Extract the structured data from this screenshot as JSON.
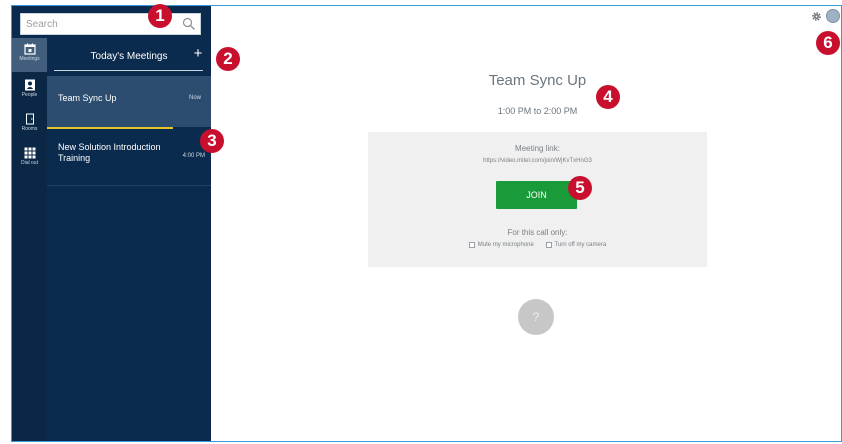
{
  "search": {
    "placeholder": "Search"
  },
  "rail": {
    "items": [
      {
        "label": "Meetings",
        "icon": "calendar-icon",
        "active": true
      },
      {
        "label": "People",
        "icon": "contact-card-icon",
        "active": false
      },
      {
        "label": "Rooms",
        "icon": "door-icon",
        "active": false
      },
      {
        "label": "Dial out",
        "icon": "dialpad-icon",
        "active": false
      }
    ]
  },
  "list": {
    "title": "Today's Meetings",
    "add_label": "+",
    "meetings": [
      {
        "name": "Team Sync Up",
        "time": "Now",
        "progress": 0.77
      },
      {
        "name": "New Solution Introduction Training",
        "time": "4:00 PM"
      }
    ]
  },
  "detail": {
    "title": "Team Sync Up",
    "time_range": "1:00 PM to 2:00 PM",
    "link_label": "Meeting link:",
    "link_url": "https://video.mitel.com/join/WjKvTxHnG3",
    "join_label": "JOIN",
    "call_only_label": "For this call only:",
    "mute_label": "Mute my microphone",
    "camera_label": "Turn off my camera",
    "help_label": "?"
  },
  "badges": [
    "1",
    "2",
    "3",
    "4",
    "5",
    "6"
  ],
  "colors": {
    "navy": "#0b2b4e",
    "selected": "#2c4d70",
    "progress": "#e2c52b",
    "join": "#1a9b3a",
    "badge": "#c8102e",
    "border": "#3a9ad9"
  }
}
